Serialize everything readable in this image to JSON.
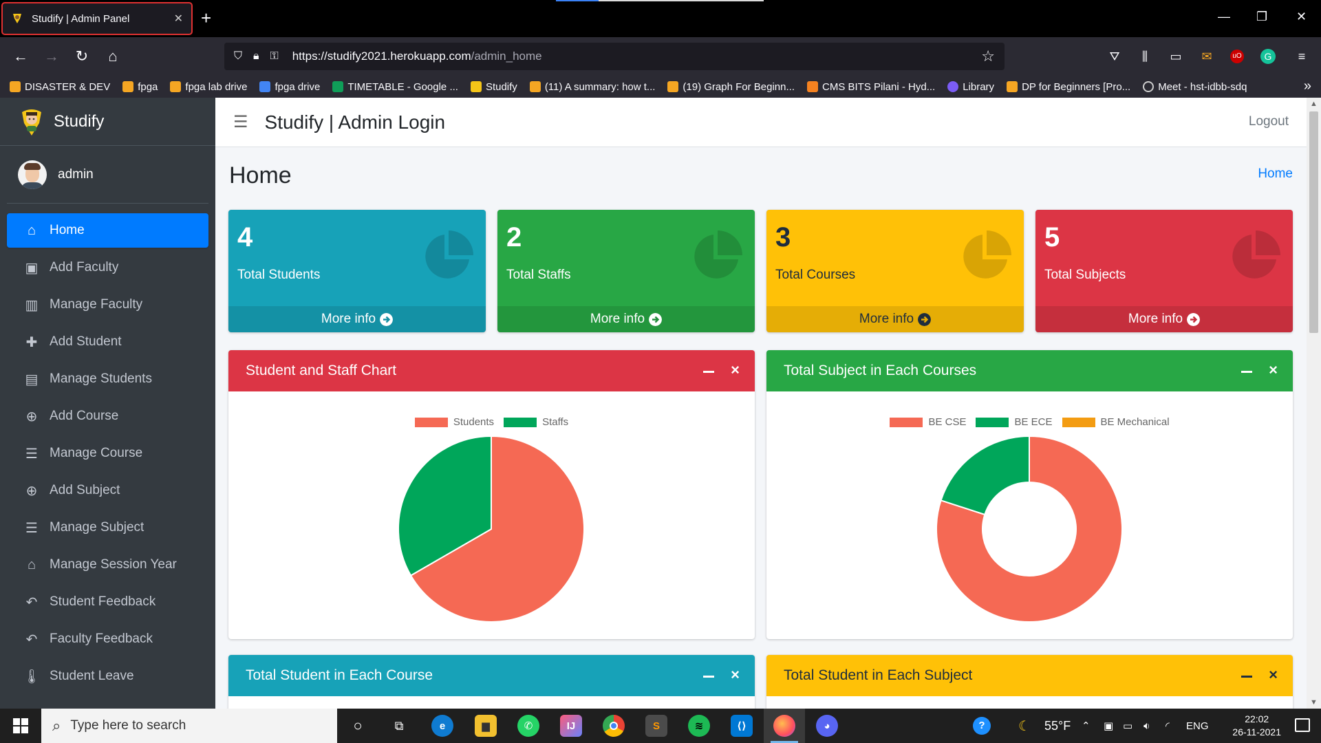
{
  "browser": {
    "tab_title": "Studify | Admin Panel",
    "url_host": "https://studify2021.herokuapp.com",
    "url_path": "/admin_home",
    "bookmarks": [
      {
        "label": "DISASTER & DEV",
        "color": "#f5a623"
      },
      {
        "label": "fpga",
        "color": "#f5a623"
      },
      {
        "label": "fpga lab drive",
        "color": "#f5a623"
      },
      {
        "label": "fpga drive",
        "color": "#4285f4"
      },
      {
        "label": "TIMETABLE - Google ...",
        "color": "#0f9d58"
      },
      {
        "label": "Studify",
        "color": "#f5c518"
      },
      {
        "label": "(11) A summary: how t...",
        "color": "#f5a623"
      },
      {
        "label": "(19) Graph For Beginn...",
        "color": "#f5a623"
      },
      {
        "label": "CMS BITS Pilani - Hyd...",
        "color": "#f58220"
      },
      {
        "label": "Library",
        "color": "#7b5cf5"
      },
      {
        "label": "DP for Beginners [Pro...",
        "color": "#f5a623"
      },
      {
        "label": "Meet - hst-idbb-sdq",
        "color": "#cccccc"
      }
    ]
  },
  "sidebar": {
    "brand": "Studify",
    "user": "admin",
    "items": [
      {
        "label": "Home",
        "icon": "home-icon",
        "glyph": "⌂"
      },
      {
        "label": "Add Faculty",
        "icon": "chalkboard-teacher-icon",
        "glyph": "▣"
      },
      {
        "label": "Manage Faculty",
        "icon": "building-icon",
        "glyph": "▥"
      },
      {
        "label": "Add Student",
        "icon": "user-plus-icon",
        "glyph": "✚"
      },
      {
        "label": "Manage Students",
        "icon": "briefcase-icon",
        "glyph": "▤"
      },
      {
        "label": "Add Course",
        "icon": "plus-circle-icon",
        "glyph": "⊕"
      },
      {
        "label": "Manage Course",
        "icon": "list-icon",
        "glyph": "☰"
      },
      {
        "label": "Add Subject",
        "icon": "plus-circle-icon",
        "glyph": "⊕"
      },
      {
        "label": "Manage Subject",
        "icon": "list-icon",
        "glyph": "☰"
      },
      {
        "label": "Manage Session Year",
        "icon": "school-icon",
        "glyph": "⌂"
      },
      {
        "label": "Student Feedback",
        "icon": "reply-icon",
        "glyph": "↶"
      },
      {
        "label": "Faculty Feedback",
        "icon": "reply-icon",
        "glyph": "↶"
      },
      {
        "label": "Student Leave",
        "icon": "thermometer-icon",
        "glyph": "🌡"
      }
    ]
  },
  "header": {
    "title": "Studify | Admin Login",
    "logout": "Logout"
  },
  "content": {
    "page_title": "Home",
    "breadcrumb": "Home",
    "boxes": [
      {
        "number": "4",
        "label": "Total Students",
        "more": "More info",
        "color": "#17a2b8"
      },
      {
        "number": "2",
        "label": "Total Staffs",
        "more": "More info",
        "color": "#28a745"
      },
      {
        "number": "3",
        "label": "Total Courses",
        "more": "More info",
        "color": "#ffc107"
      },
      {
        "number": "5",
        "label": "Total Subjects",
        "more": "More info",
        "color": "#dc3545"
      }
    ],
    "cards": [
      {
        "title": "Student and Staff Chart",
        "color": "#dc3545"
      },
      {
        "title": "Total Subject in Each Courses",
        "color": "#28a745"
      },
      {
        "title": "Total Student in Each Course",
        "color": "#17a2b8"
      },
      {
        "title": "Total Student in Each Subject",
        "color": "#ffc107"
      }
    ]
  },
  "chart_data": [
    {
      "type": "pie",
      "categories": [
        "Students",
        "Staffs"
      ],
      "values": [
        4,
        2
      ],
      "colors": [
        "#f56954",
        "#00a65a"
      ]
    },
    {
      "type": "pie",
      "variant": "doughnut",
      "categories": [
        "BE CSE",
        "BE ECE",
        "BE Mechanical"
      ],
      "values": [
        4,
        1,
        0
      ],
      "colors": [
        "#f56954",
        "#00a65a",
        "#f39c12"
      ]
    }
  ],
  "taskbar": {
    "search_placeholder": "Type here to search",
    "weather": "55°F",
    "lang": "ENG",
    "time": "22:02",
    "date": "26-11-2021"
  }
}
